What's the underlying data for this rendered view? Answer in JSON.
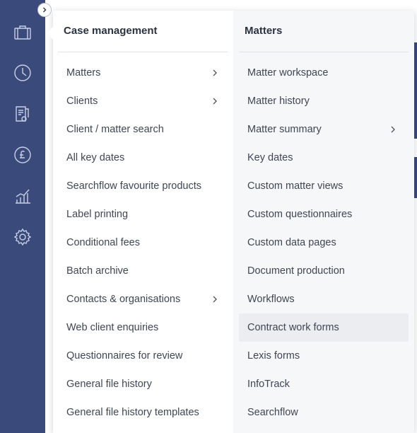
{
  "rail": {
    "icons": [
      "briefcase-icon",
      "clock-icon",
      "documents-icon",
      "pound-icon",
      "bar-chart-icon",
      "gear-icon"
    ],
    "toggle": "chevron-right-icon"
  },
  "left_column": {
    "title": "Case management",
    "items": [
      {
        "label": "Matters",
        "has_submenu": true
      },
      {
        "label": "Clients",
        "has_submenu": true
      },
      {
        "label": "Client / matter search",
        "has_submenu": false
      },
      {
        "label": "All key dates",
        "has_submenu": false
      },
      {
        "label": "Searchflow favourite products",
        "has_submenu": false
      },
      {
        "label": "Label printing",
        "has_submenu": false
      },
      {
        "label": "Conditional fees",
        "has_submenu": false
      },
      {
        "label": "Batch archive",
        "has_submenu": false
      },
      {
        "label": "Contacts & organisations",
        "has_submenu": true
      },
      {
        "label": "Web client enquiries",
        "has_submenu": false
      },
      {
        "label": "Questionnaires for review",
        "has_submenu": false
      },
      {
        "label": "General file history",
        "has_submenu": false
      },
      {
        "label": "General file history templates",
        "has_submenu": false
      }
    ]
  },
  "right_column": {
    "title": "Matters",
    "items": [
      {
        "label": "Matter workspace",
        "has_submenu": false
      },
      {
        "label": "Matter history",
        "has_submenu": false
      },
      {
        "label": "Matter summary",
        "has_submenu": true
      },
      {
        "label": "Key dates",
        "has_submenu": false
      },
      {
        "label": "Custom matter views",
        "has_submenu": false
      },
      {
        "label": "Custom questionnaires",
        "has_submenu": false
      },
      {
        "label": "Custom data pages",
        "has_submenu": false
      },
      {
        "label": "Document production",
        "has_submenu": false
      },
      {
        "label": "Workflows",
        "has_submenu": false
      },
      {
        "label": "Contract work forms",
        "has_submenu": false,
        "hovered": true
      },
      {
        "label": "Lexis forms",
        "has_submenu": false
      },
      {
        "label": "InfoTrack",
        "has_submenu": false
      },
      {
        "label": "Searchflow",
        "has_submenu": false
      }
    ]
  },
  "colors": {
    "rail": "#3a4a7a",
    "panel": "#ffffff",
    "submenu_panel": "#f6f7f9",
    "hover": "#ebedf0",
    "text": "#3e4654"
  }
}
